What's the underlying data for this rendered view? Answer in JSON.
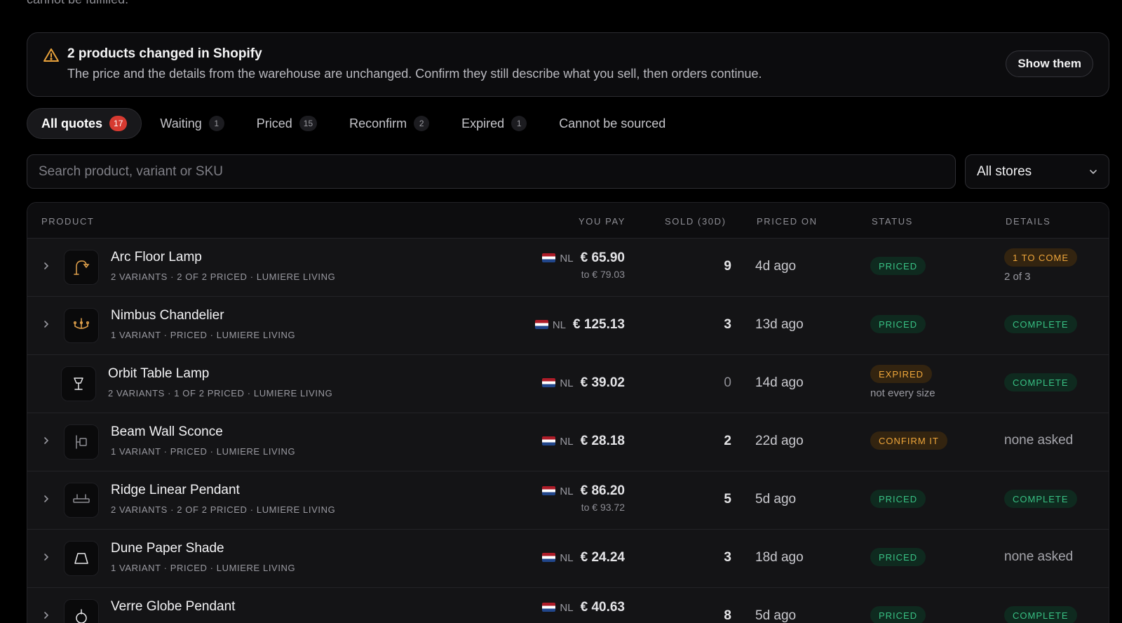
{
  "top_clipped_text": "cannot be fulfilled.",
  "banner": {
    "icon": "warning-triangle-icon",
    "title": "2 products changed in Shopify",
    "description": "The price and the details from the warehouse are unchanged. Confirm they still describe what you sell, then orders continue.",
    "button_label": "Show them"
  },
  "tabs": [
    {
      "label": "All quotes",
      "count": "17"
    },
    {
      "label": "Waiting",
      "count": "1"
    },
    {
      "label": "Priced",
      "count": "15"
    },
    {
      "label": "Reconfirm",
      "count": "2"
    },
    {
      "label": "Expired",
      "count": "1"
    },
    {
      "label": "Cannot be sourced",
      "count": ""
    }
  ],
  "search": {
    "placeholder": "Search product, variant or SKU",
    "value": ""
  },
  "store_filter": {
    "selected": "All stores"
  },
  "table": {
    "headers": {
      "product": "PRODUCT",
      "you_pay": "YOU PAY",
      "sold": "SOLD (30D)",
      "priced_on": "PRICED ON",
      "status": "STATUS",
      "details": "DETAILS"
    },
    "rows": [
      {
        "name": "Arc Floor Lamp",
        "meta": "2 VARIANTS · 2 OF 2 PRICED · LUMIERE LIVING",
        "icon": "floor-lamp-icon",
        "country": "NL",
        "price": "€ 65.90",
        "price_to": "to € 79.03",
        "sold": "9",
        "priced_on": "4d ago",
        "status": "PRICED",
        "status_sub": "",
        "details_badge": "1 TO COME",
        "details_sub": "2 of 3",
        "details_text": ""
      },
      {
        "name": "Nimbus Chandelier",
        "meta": "1 VARIANT · PRICED · LUMIERE LIVING",
        "icon": "chandelier-icon",
        "country": "NL",
        "price": "€ 125.13",
        "price_to": "",
        "sold": "3",
        "priced_on": "13d ago",
        "status": "PRICED",
        "status_sub": "",
        "details_badge": "COMPLETE",
        "details_sub": "",
        "details_text": ""
      },
      {
        "name": "Orbit Table Lamp",
        "meta": "2 VARIANTS · 1 OF 2 PRICED · LUMIERE LIVING",
        "icon": "table-lamp-icon",
        "country": "NL",
        "price": "€ 39.02",
        "price_to": "",
        "sold": "0",
        "priced_on": "14d ago",
        "status": "EXPIRED",
        "status_sub": "not every size",
        "details_badge": "COMPLETE",
        "details_sub": "",
        "details_text": ""
      },
      {
        "name": "Beam Wall Sconce",
        "meta": "1 VARIANT · PRICED · LUMIERE LIVING",
        "icon": "wall-sconce-icon",
        "country": "NL",
        "price": "€ 28.18",
        "price_to": "",
        "sold": "2",
        "priced_on": "22d ago",
        "status": "CONFIRM IT",
        "status_sub": "",
        "details_badge": "",
        "details_sub": "",
        "details_text": "none asked"
      },
      {
        "name": "Ridge Linear Pendant",
        "meta": "2 VARIANTS · 2 OF 2 PRICED · LUMIERE LIVING",
        "icon": "linear-pendant-icon",
        "country": "NL",
        "price": "€ 86.20",
        "price_to": "to € 93.72",
        "sold": "5",
        "priced_on": "5d ago",
        "status": "PRICED",
        "status_sub": "",
        "details_badge": "COMPLETE",
        "details_sub": "",
        "details_text": ""
      },
      {
        "name": "Dune Paper Shade",
        "meta": "1 VARIANT · PRICED · LUMIERE LIVING",
        "icon": "paper-shade-icon",
        "country": "NL",
        "price": "€ 24.24",
        "price_to": "",
        "sold": "3",
        "priced_on": "18d ago",
        "status": "PRICED",
        "status_sub": "",
        "details_badge": "",
        "details_sub": "",
        "details_text": "none asked"
      },
      {
        "name": "Verre Globe Pendant",
        "meta": "",
        "icon": "globe-pendant-icon",
        "country": "NL",
        "price": "€ 40.63",
        "price_to": "",
        "sold": "8",
        "priced_on": "5d ago",
        "status": "PRICED",
        "status_sub": "",
        "details_badge": "COMPLETE",
        "details_sub": "",
        "details_text": ""
      }
    ]
  },
  "colors": {
    "background": "#000000",
    "accent_red": "#d63a31",
    "status_green": "#38c184",
    "status_amber": "#efa63a"
  }
}
